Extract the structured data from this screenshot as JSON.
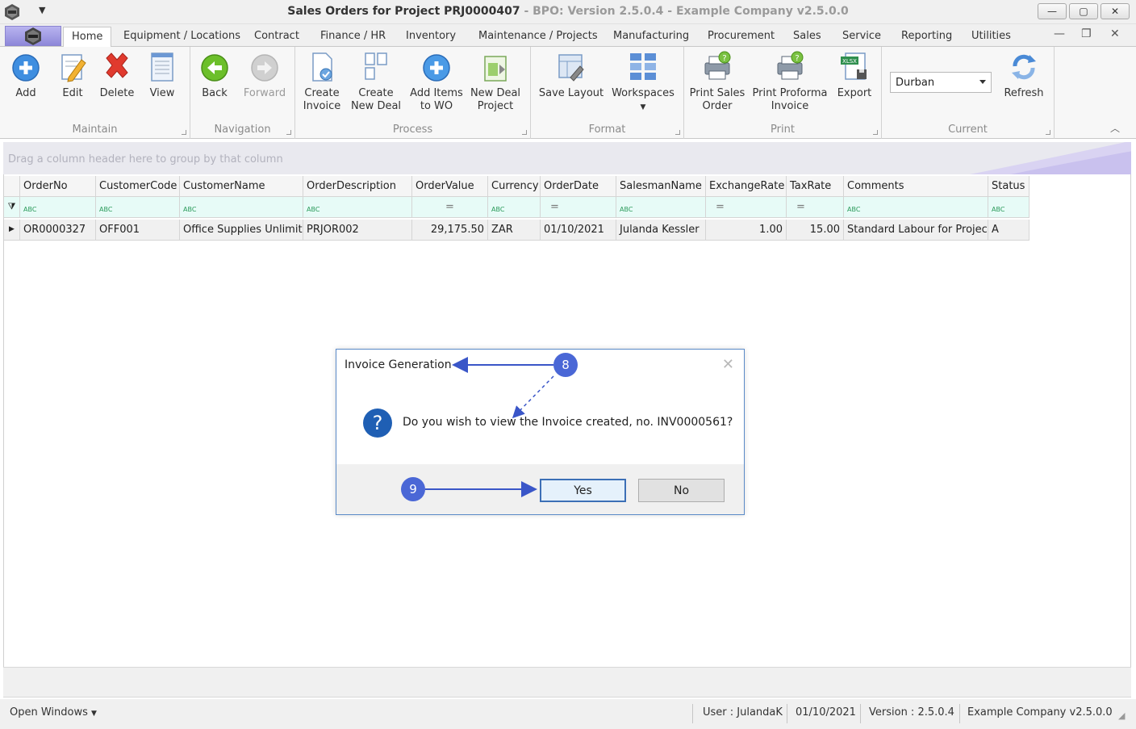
{
  "window": {
    "title_main": "Sales Orders for Project PRJ0000407",
    "title_sub": " - BPO: Version 2.5.0.4 - Example Company v2.5.0.0",
    "minimize": "—",
    "maximize": "▢",
    "close": "✕"
  },
  "tabs": [
    "Home",
    "Equipment / Locations",
    "Contract",
    "Finance / HR",
    "Inventory",
    "Maintenance / Projects",
    "Manufacturing",
    "Procurement",
    "Sales",
    "Service",
    "Reporting",
    "Utilities"
  ],
  "mdi": {
    "minimize": "—",
    "restore": "❐",
    "close": "✕"
  },
  "ribbon": {
    "groups": {
      "maintain": "Maintain",
      "navigation": "Navigation",
      "process": "Process",
      "format": "Format",
      "print": "Print",
      "current": "Current"
    },
    "buttons": {
      "add": "Add",
      "edit": "Edit",
      "delete": "Delete",
      "view": "View",
      "back": "Back",
      "forward": "Forward",
      "create_invoice_1": "Create",
      "create_invoice_2": "Invoice",
      "create_new_deal_1": "Create",
      "create_new_deal_2": "New Deal",
      "add_items_wo_1": "Add Items",
      "add_items_wo_2": "to WO",
      "new_deal_project_1": "New Deal",
      "new_deal_project_2": "Project",
      "save_layout": "Save Layout",
      "workspaces": "Workspaces",
      "print_sales_order_1": "Print Sales",
      "print_sales_order_2": "Order",
      "print_proforma_1": "Print Proforma",
      "print_proforma_2": "Invoice",
      "export": "Export",
      "refresh": "Refresh"
    },
    "current_site": "Durban",
    "export_badge": "XLSX"
  },
  "grid": {
    "group_hint": "Drag a column header here to group by that column",
    "columns": [
      "OrderNo",
      "CustomerCode",
      "CustomerName",
      "OrderDescription",
      "OrderValue",
      "Currency",
      "OrderDate",
      "SalesmanName",
      "ExchangeRate",
      "TaxRate",
      "Comments",
      "Status"
    ],
    "filter_text": "ᴿ",
    "rows": [
      [
        "OR0000327",
        "OFF001",
        "Office Supplies Unlimit...",
        "PRJOR002",
        "29,175.50",
        "ZAR",
        "01/10/2021",
        "Julanda Kessler",
        "1.00",
        "15.00",
        "Standard Labour for Project",
        "A"
      ]
    ]
  },
  "dialog": {
    "title": "Invoice Generation",
    "message": "Do you wish to view the Invoice created, no. INV0000561?",
    "yes": "Yes",
    "no": "No",
    "question_glyph": "?",
    "close_glyph": "✕"
  },
  "annotations": {
    "step_8": "8",
    "step_9": "9"
  },
  "statusbar": {
    "open_windows": "Open Windows",
    "user": "User : JulandaK",
    "date": "01/10/2021",
    "version": "Version : 2.5.0.4",
    "company": "Example Company v2.5.0.0"
  },
  "colors": {
    "accent": "#4a67d6",
    "dialog_border": "#5a8ac8",
    "filter_row": "#e7fbf7"
  }
}
